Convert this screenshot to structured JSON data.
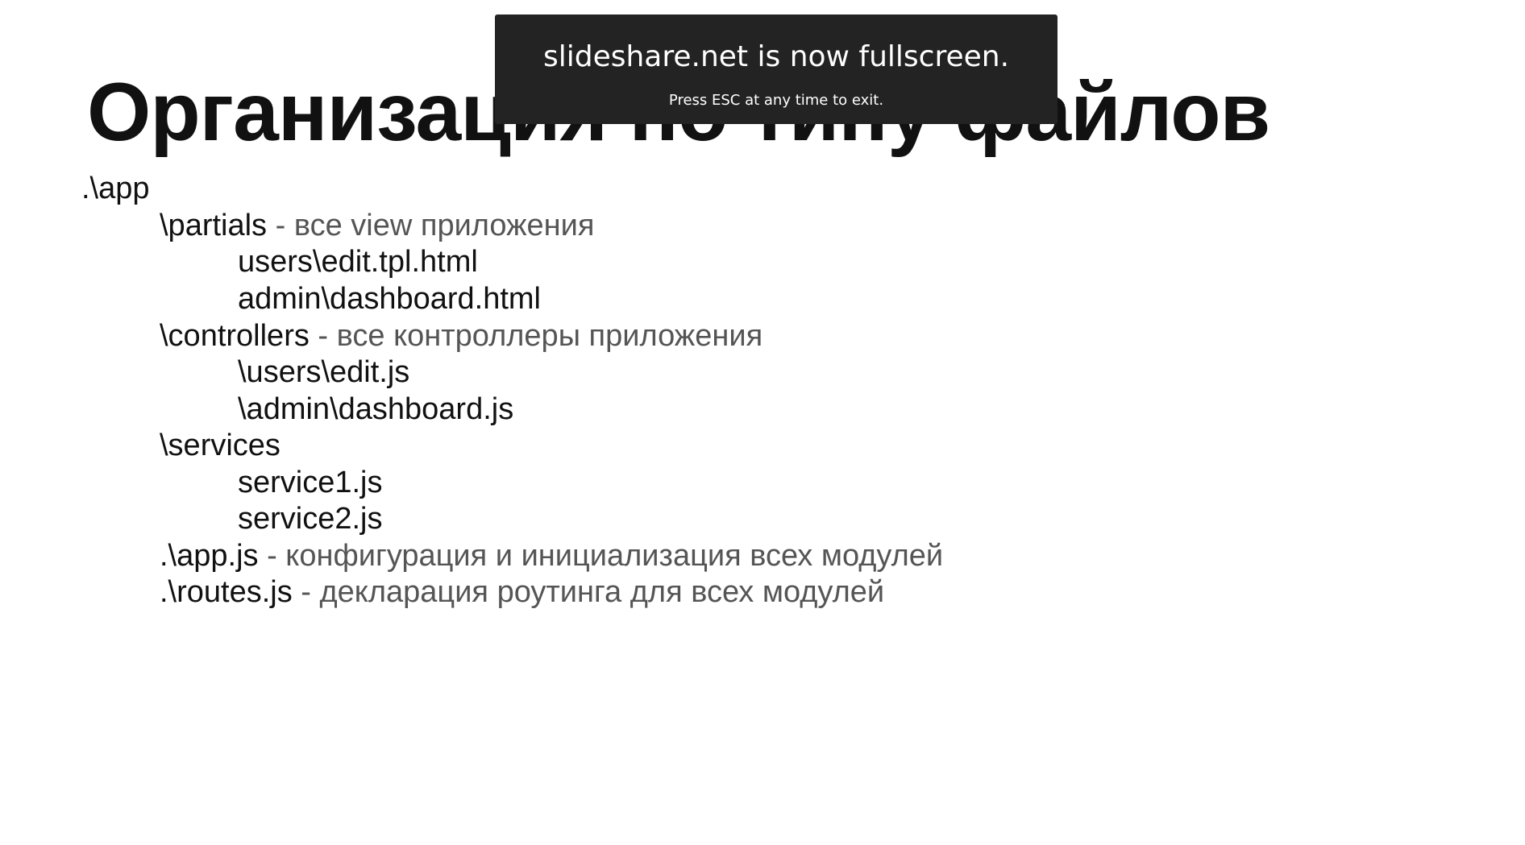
{
  "slide": {
    "title": "Организация по типу файлов",
    "lines": [
      {
        "path": ".\\app",
        "desc": ""
      },
      {
        "path": "\\partials",
        "desc": " - все view приложения"
      },
      {
        "path": "users\\edit.tpl.html",
        "desc": ""
      },
      {
        "path": "admin\\dashboard.html",
        "desc": ""
      },
      {
        "path": "\\controllers ",
        "desc": " - все контроллеры приложения"
      },
      {
        "path": "\\users\\edit.js",
        "desc": ""
      },
      {
        "path": "\\admin\\dashboard.js",
        "desc": ""
      },
      {
        "path": "\\services",
        "desc": ""
      },
      {
        "path": "service1.js",
        "desc": ""
      },
      {
        "path": "service2.js",
        "desc": ""
      },
      {
        "path": ".\\app.js",
        "desc": " - конфигурация и инициализация всех модулей"
      },
      {
        "path": ".\\routes.js",
        "desc": " - декларация роутинга для всех модулей"
      }
    ]
  },
  "fullscreen_notice": {
    "title": "slideshare.net is now fullscreen.",
    "subtitle": "Press ESC at any time to exit."
  },
  "colors": {
    "notice_background": "#232323",
    "text": "#111111",
    "description_text": "#555555"
  }
}
